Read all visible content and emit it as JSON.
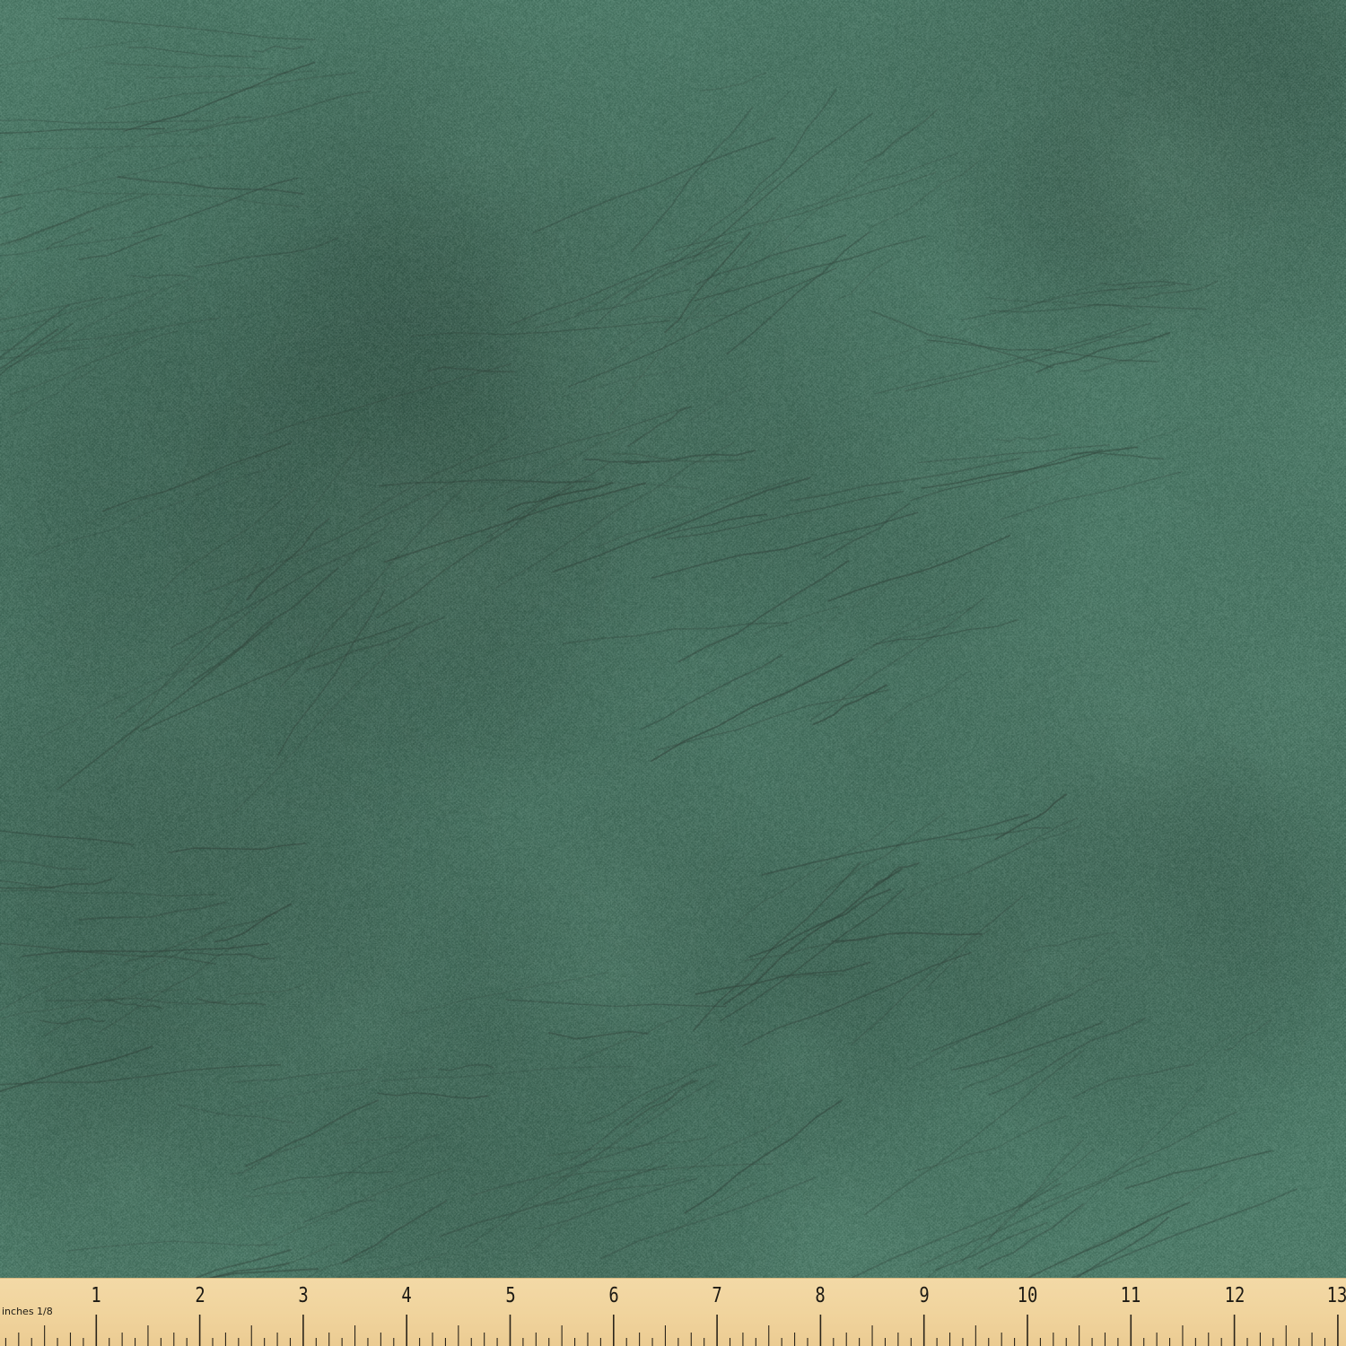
{
  "image": {
    "subject": "green-textured-fabric-swatch",
    "fabric_color": "#4f7c6a",
    "crack_color": "#2f3f37"
  },
  "ruler": {
    "unit_label": "inches 1/8",
    "numbers": [
      "1",
      "2",
      "3",
      "4",
      "5",
      "6",
      "7",
      "8",
      "9",
      "10",
      "11",
      "12",
      "13"
    ],
    "color": "#f0d39c"
  }
}
